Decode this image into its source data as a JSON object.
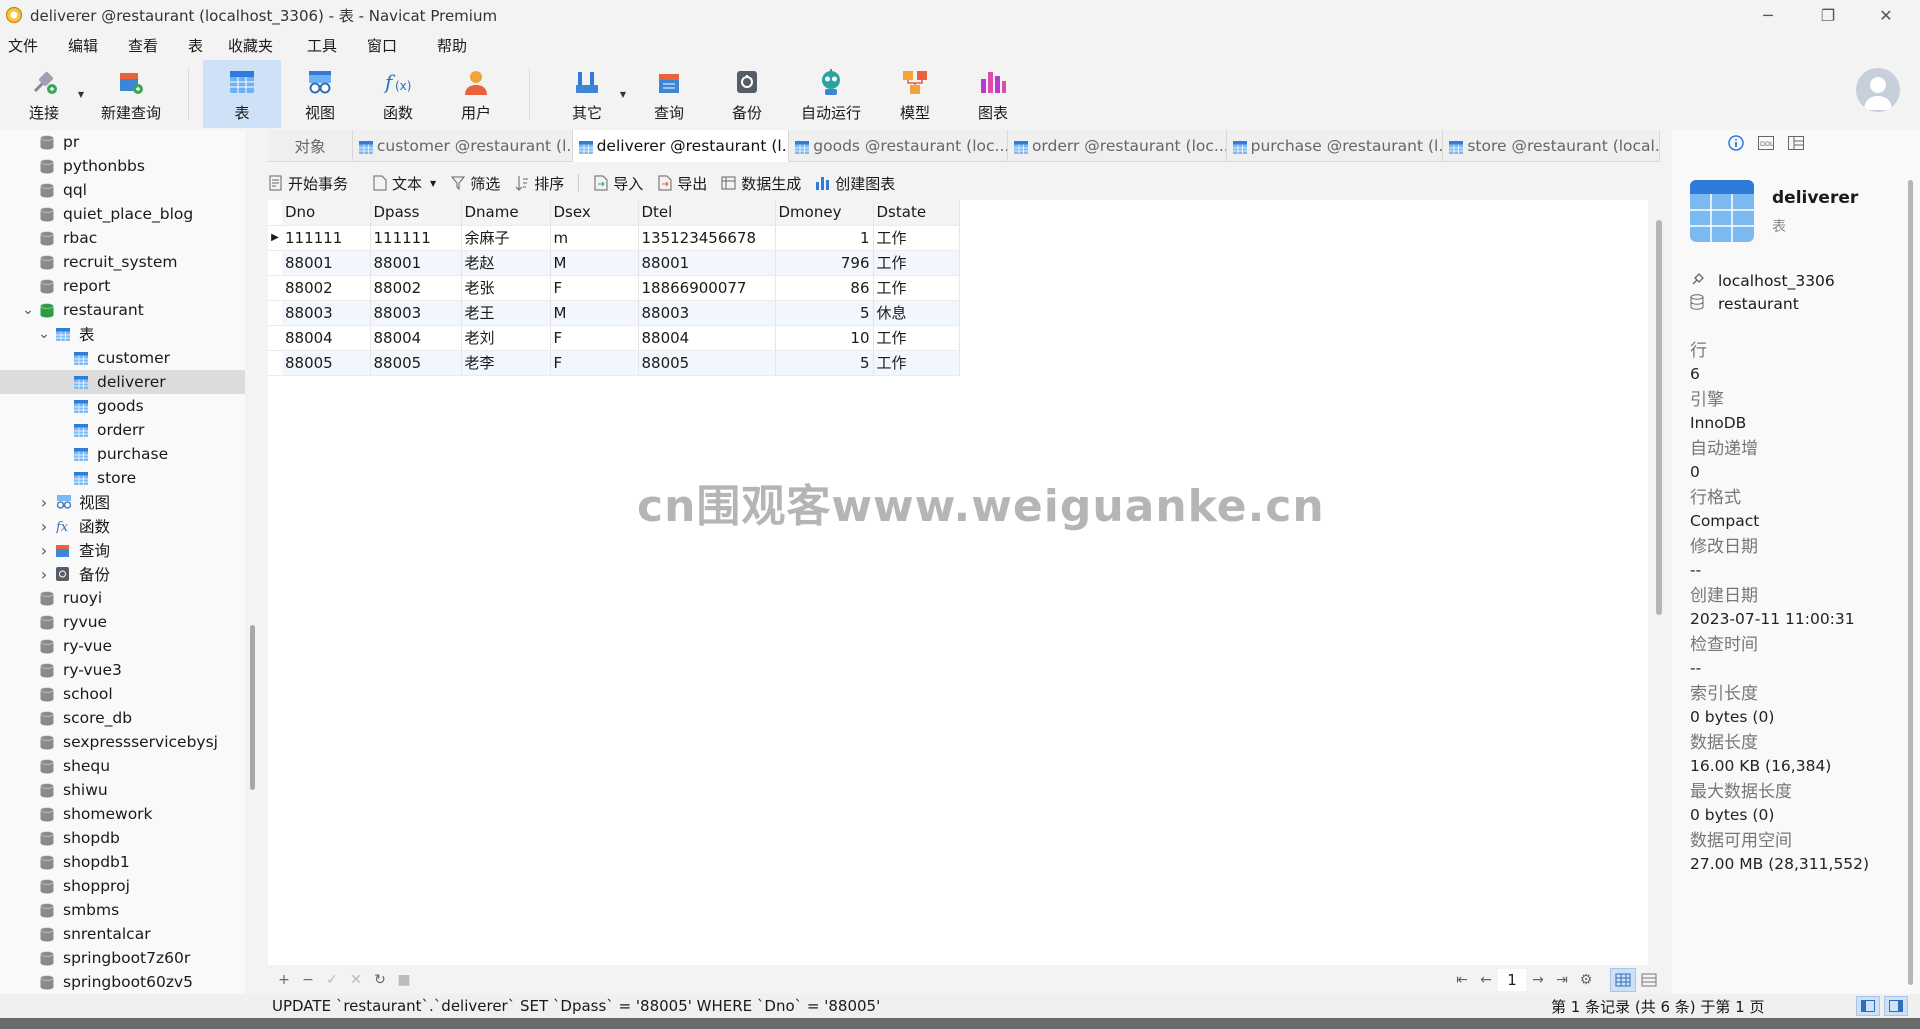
{
  "window": {
    "title": "deliverer @restaurant (localhost_3306) - 表 - Navicat Premium",
    "minimize": "─",
    "maximize": "❐",
    "close": "✕"
  },
  "menu": [
    "文件",
    "编辑",
    "查看",
    "表",
    "收藏夹",
    "工具",
    "窗口",
    "帮助"
  ],
  "toolbar": {
    "connect": "连接",
    "new_query": "新建查询",
    "table": "表",
    "view": "视图",
    "function": "函数",
    "user": "用户",
    "other": "其它",
    "query": "查询",
    "backup": "备份",
    "automation": "自动运行",
    "model": "模型",
    "chart": "图表"
  },
  "tree": {
    "databases_top": [
      "pr",
      "pythonbbs",
      "qql",
      "quiet_place_blog",
      "rbac",
      "recruit_system",
      "report"
    ],
    "current_db": "restaurant",
    "tables_folder": "表",
    "tables": [
      "customer",
      "deliverer",
      "goods",
      "orderr",
      "purchase",
      "store"
    ],
    "selected_table": "deliverer",
    "folders": [
      "视图",
      "函数",
      "查询",
      "备份"
    ],
    "databases_bottom": [
      "ruoyi",
      "ryvue",
      "ry-vue",
      "ry-vue3",
      "school",
      "score_db",
      "sexpressservicebysj",
      "shequ",
      "shiwu",
      "shomework",
      "shopdb",
      "shopdb1",
      "shopproj",
      "smbms",
      "snrentalcar",
      "springboot7z60r",
      "springboot60zv5"
    ]
  },
  "tabs": [
    {
      "label": "对象",
      "icon": false,
      "active": false
    },
    {
      "label": "customer @restaurant (l...",
      "icon": true,
      "active": false
    },
    {
      "label": "deliverer @restaurant (l...",
      "icon": true,
      "active": true
    },
    {
      "label": "goods @restaurant (loc...",
      "icon": true,
      "active": false
    },
    {
      "label": "orderr @restaurant (loc...",
      "icon": true,
      "active": false
    },
    {
      "label": "purchase @restaurant (l...",
      "icon": true,
      "active": false
    },
    {
      "label": "store @restaurant (local...",
      "icon": true,
      "active": false
    }
  ],
  "subtoolbar": {
    "begin_transaction": "开始事务",
    "text": "文本",
    "filter": "筛选",
    "sort": "排序",
    "import": "导入",
    "export": "导出",
    "data_generation": "数据生成",
    "create_chart": "创建图表"
  },
  "grid": {
    "columns": [
      "Dno",
      "Dpass",
      "Dname",
      "Dsex",
      "Dtel",
      "Dmoney",
      "Dstate"
    ],
    "rows": [
      [
        "111111",
        "111111",
        "余麻子",
        "m",
        "135123456678",
        "1",
        "工作"
      ],
      [
        "88001",
        "88001",
        "老赵",
        "M",
        "88001",
        "796",
        "工作"
      ],
      [
        "88002",
        "88002",
        "老张",
        "F",
        "18866900077",
        "86",
        "工作"
      ],
      [
        "88003",
        "88003",
        "老王",
        "M",
        "88003",
        "5",
        "休息"
      ],
      [
        "88004",
        "88004",
        "老刘",
        "F",
        "88004",
        "10",
        "工作"
      ],
      [
        "88005",
        "88005",
        "老李",
        "F",
        "88005",
        "5",
        "工作"
      ]
    ]
  },
  "watermark": "cn围观客www.weiguanke.cn",
  "gridbar": {
    "add": "+",
    "remove": "−",
    "apply": "✓",
    "discard": "✕",
    "refresh": "↻",
    "stop": "■",
    "first": "⇤",
    "prev": "←",
    "page": "1",
    "next": "→",
    "last": "⇥",
    "settings": "⚙"
  },
  "status": {
    "sql": "UPDATE `restaurant`.`deliverer` SET `Dpass` = '88005' WHERE `Dno` = '88005'",
    "records": "第 1 条记录 (共 6 条) 于第 1 页"
  },
  "info": {
    "name": "deliverer",
    "type": "表",
    "connection": "localhost_3306",
    "database": "restaurant",
    "props": [
      {
        "k": "行",
        "v": "6"
      },
      {
        "k": "引擎",
        "v": "InnoDB"
      },
      {
        "k": "自动递增",
        "v": "0"
      },
      {
        "k": "行格式",
        "v": "Compact"
      },
      {
        "k": "修改日期",
        "v": "--"
      },
      {
        "k": "创建日期",
        "v": "2023-07-11 11:00:31"
      },
      {
        "k": "检查时间",
        "v": "--"
      },
      {
        "k": "索引长度",
        "v": "0 bytes (0)"
      },
      {
        "k": "数据长度",
        "v": "16.00 KB (16,384)"
      },
      {
        "k": "最大数据长度",
        "v": "0 bytes (0)"
      },
      {
        "k": "数据可用空间",
        "v": "27.00 MB (28,311,552)"
      }
    ]
  },
  "colors": {
    "accent": "#2f7bd9",
    "selection": "#cfe1f7",
    "db_gray": "#8a8a8a",
    "db_green": "#2e9b45"
  }
}
